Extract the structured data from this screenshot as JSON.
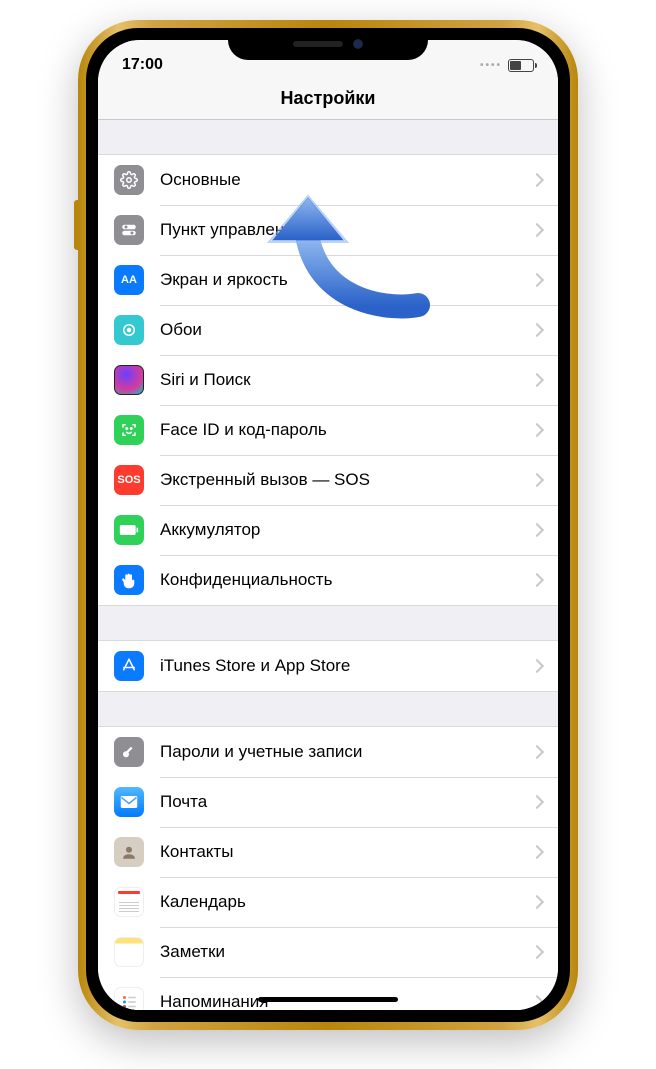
{
  "status": {
    "time": "17:00"
  },
  "header": {
    "title": "Настройки"
  },
  "groups": [
    {
      "items": [
        {
          "key": "general",
          "label": "Основные",
          "icon": "gear-icon"
        },
        {
          "key": "control",
          "label": "Пункт управления",
          "icon": "toggles-icon"
        },
        {
          "key": "display",
          "label": "Экран и яркость",
          "icon": "display-icon"
        },
        {
          "key": "wallpaper",
          "label": "Обои",
          "icon": "wallpaper-icon"
        },
        {
          "key": "siri",
          "label": "Siri и Поиск",
          "icon": "siri-icon"
        },
        {
          "key": "faceid",
          "label": "Face ID и код-пароль",
          "icon": "faceid-icon"
        },
        {
          "key": "sos",
          "label": "Экстренный вызов — SOS",
          "icon": "sos-icon"
        },
        {
          "key": "battery",
          "label": "Аккумулятор",
          "icon": "battery-icon"
        },
        {
          "key": "privacy",
          "label": "Конфиденциальность",
          "icon": "hand-icon"
        }
      ]
    },
    {
      "items": [
        {
          "key": "itunes",
          "label": "iTunes Store и App Store",
          "icon": "appstore-icon"
        }
      ]
    },
    {
      "items": [
        {
          "key": "passwords",
          "label": "Пароли и учетные записи",
          "icon": "key-icon"
        },
        {
          "key": "mail",
          "label": "Почта",
          "icon": "mail-icon"
        },
        {
          "key": "contacts",
          "label": "Контакты",
          "icon": "contacts-icon"
        },
        {
          "key": "calendar",
          "label": "Календарь",
          "icon": "calendar-icon"
        },
        {
          "key": "notes",
          "label": "Заметки",
          "icon": "notes-icon"
        },
        {
          "key": "reminders",
          "label": "Напоминания",
          "icon": "reminders-icon"
        }
      ]
    }
  ],
  "iconText": {
    "sos": "SOS",
    "display": "AA"
  },
  "annotation": {
    "arrow_target": "general"
  }
}
